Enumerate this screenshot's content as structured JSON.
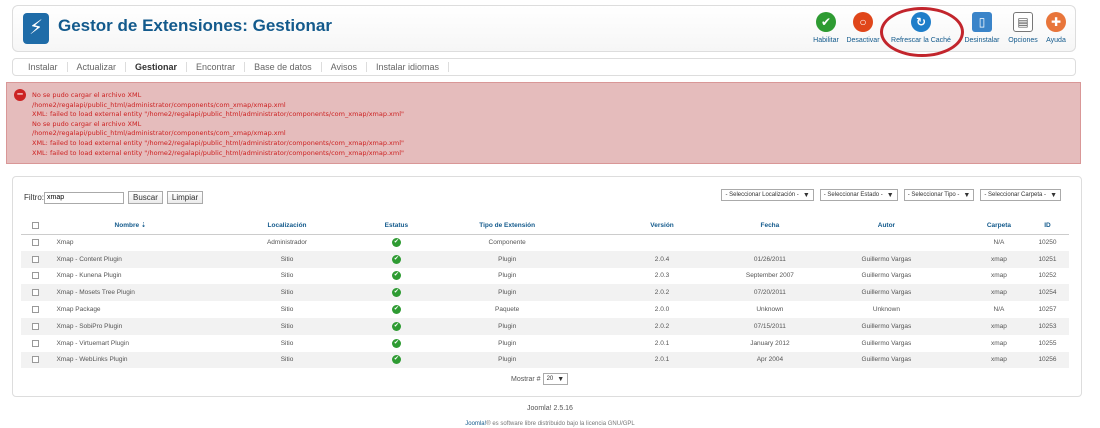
{
  "header": {
    "logo": "⚡",
    "title": "Gestor de Extensiones: Gestionar"
  },
  "toolbar": [
    {
      "label": "Habilitar",
      "icon": "enable-icon",
      "color": "#2e9b32",
      "glyph": "✔",
      "width": 34
    },
    {
      "label": "Desactivar",
      "icon": "disable-icon",
      "color": "#e0461a",
      "glyph": "○",
      "width": 40
    },
    {
      "label": "Refrescar la Caché",
      "icon": "refresh-cache-icon",
      "color": "#1f7ec9",
      "glyph": "↻",
      "width": 76
    },
    {
      "label": "Desinstalar",
      "icon": "trash-icon",
      "color": "#3a84c9",
      "glyph": "▯",
      "width": 46
    },
    {
      "label": "Opciones",
      "icon": "options-icon",
      "color": "#888888",
      "glyph": "▤",
      "width": 36
    },
    {
      "label": "Ayuda",
      "icon": "help-icon",
      "color": "#e8753a",
      "glyph": "✚",
      "width": 30
    }
  ],
  "submenu": [
    "Instalar",
    "Actualizar",
    "Gestionar",
    "Encontrar",
    "Base de datos",
    "Avisos",
    "Instalar idiomas"
  ],
  "submenu_active": "Gestionar",
  "errors": [
    "No se pudo cargar el archivo XML",
    "/home2/regalapi/public_html/administrator/components/com_xmap/xmap.xml",
    "XML: failed to load external entity \"/home2/regalapi/public_html/administrator/components/com_xmap/xmap.xml\"",
    "No se pudo cargar el archivo XML",
    "/home2/regalapi/public_html/administrator/components/com_xmap/xmap.xml",
    "XML: failed to load external entity \"/home2/regalapi/public_html/administrator/components/com_xmap/xmap.xml\"",
    "XML: failed to load external entity \"/home2/regalapi/public_html/administrator/components/com_xmap/xmap.xml\""
  ],
  "filter": {
    "label": "Filtro:",
    "value": "xmap",
    "search_btn": "Buscar",
    "clear_btn": "Limpiar"
  },
  "selects": [
    "- Seleccionar Localización -",
    "- Seleccionar Estado -",
    "- Seleccionar Tipo -",
    "- Seleccionar Carpeta -"
  ],
  "table": {
    "columns": [
      "Nombre",
      "Localización",
      "Estatus",
      "Tipo de Extensión",
      "Versión",
      "Fecha",
      "Autor",
      "Carpeta",
      "ID"
    ],
    "rows": [
      [
        "Xmap",
        "Administrador",
        "ok",
        "Componente",
        "",
        "",
        "",
        "N/A",
        "10250"
      ],
      [
        "Xmap - Content Plugin",
        "Sitio",
        "ok",
        "Plugin",
        "2.0.4",
        "01/26/2011",
        "Guillermo Vargas",
        "xmap",
        "10251"
      ],
      [
        "Xmap - Kunena Plugin",
        "Sitio",
        "ok",
        "Plugin",
        "2.0.3",
        "September 2007",
        "Guillermo Vargas",
        "xmap",
        "10252"
      ],
      [
        "Xmap - Mosets Tree Plugin",
        "Sitio",
        "ok",
        "Plugin",
        "2.0.2",
        "07/20/2011",
        "Guillermo Vargas",
        "xmap",
        "10254"
      ],
      [
        "Xmap Package",
        "Sitio",
        "ok",
        "Paquete",
        "2.0.0",
        "Unknown",
        "Unknown",
        "N/A",
        "10257"
      ],
      [
        "Xmap - SobiPro Plugin",
        "Sitio",
        "ok",
        "Plugin",
        "2.0.2",
        "07/15/2011",
        "Guillermo Vargas",
        "xmap",
        "10253"
      ],
      [
        "Xmap - Virtuemart Plugin",
        "Sitio",
        "ok",
        "Plugin",
        "2.0.1",
        "January 2012",
        "Guillermo Vargas",
        "xmap",
        "10255"
      ],
      [
        "Xmap - WebLinks Plugin",
        "Sitio",
        "ok",
        "Plugin",
        "2.0.1",
        "Apr 2004",
        "Guillermo Vargas",
        "xmap",
        "10256"
      ]
    ]
  },
  "pager": {
    "label": "Mostrar #",
    "value": "20"
  },
  "footer": {
    "version": "Joomla! 2.5.16",
    "license_link": "Joomla!",
    "license_text": "® es software libre distribuido bajo la licencia GNU/GPL"
  },
  "colors": {
    "accent": "#135a8c",
    "error_bg": "#e5bcbc",
    "error_text": "#cc2222",
    "annotation": "#c2252c"
  }
}
